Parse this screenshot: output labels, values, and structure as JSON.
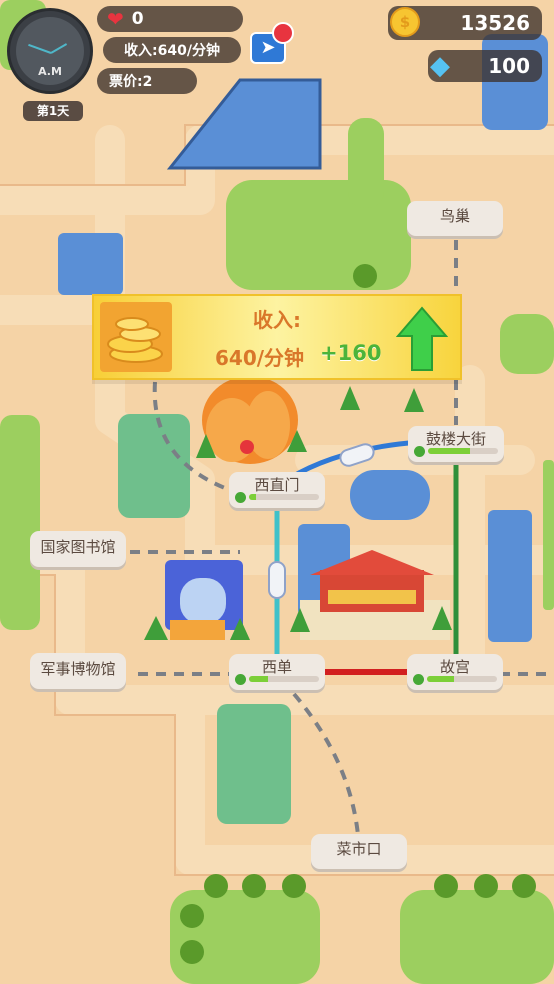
{
  "hud": {
    "clock_label": "A.M",
    "day_label": "第1天",
    "hearts_value": "0",
    "income_label": "收入:640/分钟",
    "ticket_label": "票价:2",
    "coins_value": "13526",
    "gems_value": "100"
  },
  "stations": [
    {
      "name": "鸟巢",
      "progress": null
    },
    {
      "name": "鼓楼大街",
      "progress": 0.6
    },
    {
      "name": "西直门",
      "progress": 0.1
    },
    {
      "name": "国家图书馆",
      "progress": null
    },
    {
      "name": "军事博物馆",
      "progress": null
    },
    {
      "name": "西单",
      "progress": 0.27
    },
    {
      "name": "故宫",
      "progress": 0.38
    },
    {
      "name": "菜市口",
      "progress": null
    }
  ],
  "banner": {
    "title": "收入:",
    "rate": "640/分钟",
    "bonus": "+160"
  },
  "colors": {
    "line_red": "#d21f1f",
    "line_cyan": "#3fc1c9",
    "line_blue": "#2f79d6",
    "line_green": "#2f8f3a",
    "grass": "#9ccf5f",
    "water": "#5a8fd6",
    "road": "#f3c79a"
  },
  "icons": {
    "heart": "heart-icon",
    "coin": "coin-icon",
    "gem": "diamond-icon",
    "quest": "rocket-icon",
    "income_arrow": "up-arrow-icon"
  }
}
